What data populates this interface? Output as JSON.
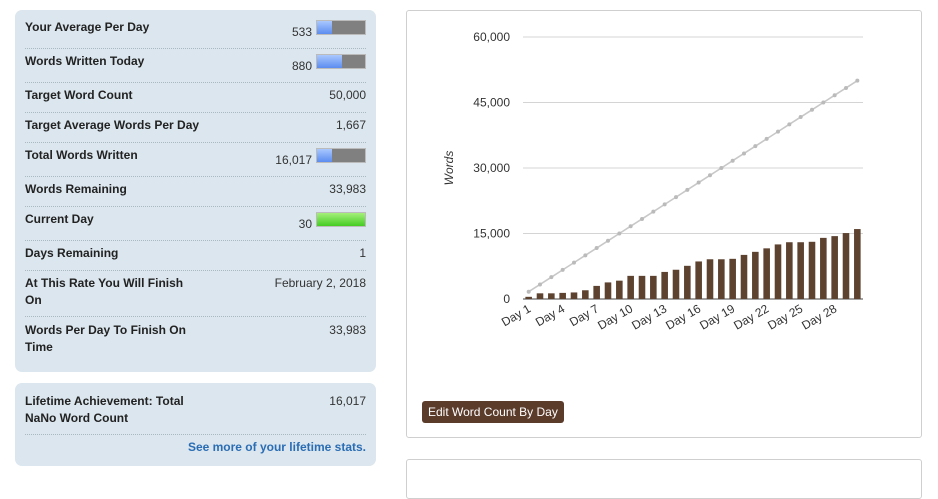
{
  "stats": {
    "average_per_day": {
      "label": "Your Average Per Day",
      "value": "533",
      "bar_fraction": 0.32
    },
    "words_today": {
      "label": "Words Written Today",
      "value": "880",
      "bar_fraction": 0.53
    },
    "target_word_count": {
      "label": "Target Word Count",
      "value": "50,000"
    },
    "target_avg": {
      "label": "Target Average Words Per Day",
      "value": "1,667"
    },
    "total_written": {
      "label": "Total Words Written",
      "value": "16,017",
      "bar_fraction": 0.32
    },
    "words_remaining": {
      "label": "Words Remaining",
      "value": "33,983"
    },
    "current_day": {
      "label": "Current Day",
      "value": "30",
      "bar_fraction": 1.0
    },
    "days_remaining": {
      "label": "Days Remaining",
      "value": "1"
    },
    "finish_date": {
      "label_line1": "At This Rate You Will Finish",
      "label_line2": "On",
      "value": "February 2, 2018"
    },
    "words_per_day_finish": {
      "label_line1": "Words Per Day To Finish On",
      "label_line2": "Time",
      "value": "33,983"
    }
  },
  "lifetime": {
    "label_line1": "Lifetime Achievement: Total",
    "label_line2": "NaNo Word Count",
    "value": "16,017",
    "link": "See more of your lifetime stats."
  },
  "edit_button": "Edit Word Count By Day",
  "colors": {
    "bar": "#5d4230",
    "target_line": "#c8c8c8",
    "panel": "#dbe6ee",
    "link": "#2a6db4"
  },
  "chart_data": {
    "type": "bar",
    "ylabel": "Words",
    "ylim": [
      0,
      60000
    ],
    "yticks": [
      "0",
      "15,000",
      "30,000",
      "45,000",
      "60,000"
    ],
    "ytick_values": [
      0,
      15000,
      30000,
      45000,
      60000
    ],
    "categories": [
      "Day 1",
      "Day 2",
      "Day 3",
      "Day 4",
      "Day 5",
      "Day 6",
      "Day 7",
      "Day 8",
      "Day 9",
      "Day 10",
      "Day 11",
      "Day 12",
      "Day 13",
      "Day 14",
      "Day 15",
      "Day 16",
      "Day 17",
      "Day 18",
      "Day 19",
      "Day 20",
      "Day 21",
      "Day 22",
      "Day 23",
      "Day 24",
      "Day 25",
      "Day 26",
      "Day 27",
      "Day 28",
      "Day 29",
      "Day 30"
    ],
    "shown_xticks": [
      "Day 1",
      "Day 4",
      "Day 7",
      "Day 10",
      "Day 13",
      "Day 16",
      "Day 19",
      "Day 22",
      "Day 25",
      "Day 28"
    ],
    "series": [
      {
        "type": "bar",
        "values": [
          500,
          1300,
          1300,
          1400,
          1500,
          2000,
          3000,
          3800,
          4200,
          5300,
          5300,
          5300,
          6200,
          6700,
          7600,
          8600,
          9100,
          9100,
          9200,
          10100,
          10800,
          11600,
          12500,
          13000,
          13000,
          13100,
          14000,
          14400,
          15100,
          16017
        ]
      },
      {
        "type": "line",
        "values": [
          1667,
          3333,
          5000,
          6667,
          8333,
          10000,
          11667,
          13333,
          15000,
          16667,
          18333,
          20000,
          21667,
          23333,
          25000,
          26667,
          28333,
          30000,
          31667,
          33333,
          35000,
          36667,
          38333,
          40000,
          41667,
          43333,
          45000,
          46667,
          48333,
          50000
        ]
      }
    ]
  }
}
